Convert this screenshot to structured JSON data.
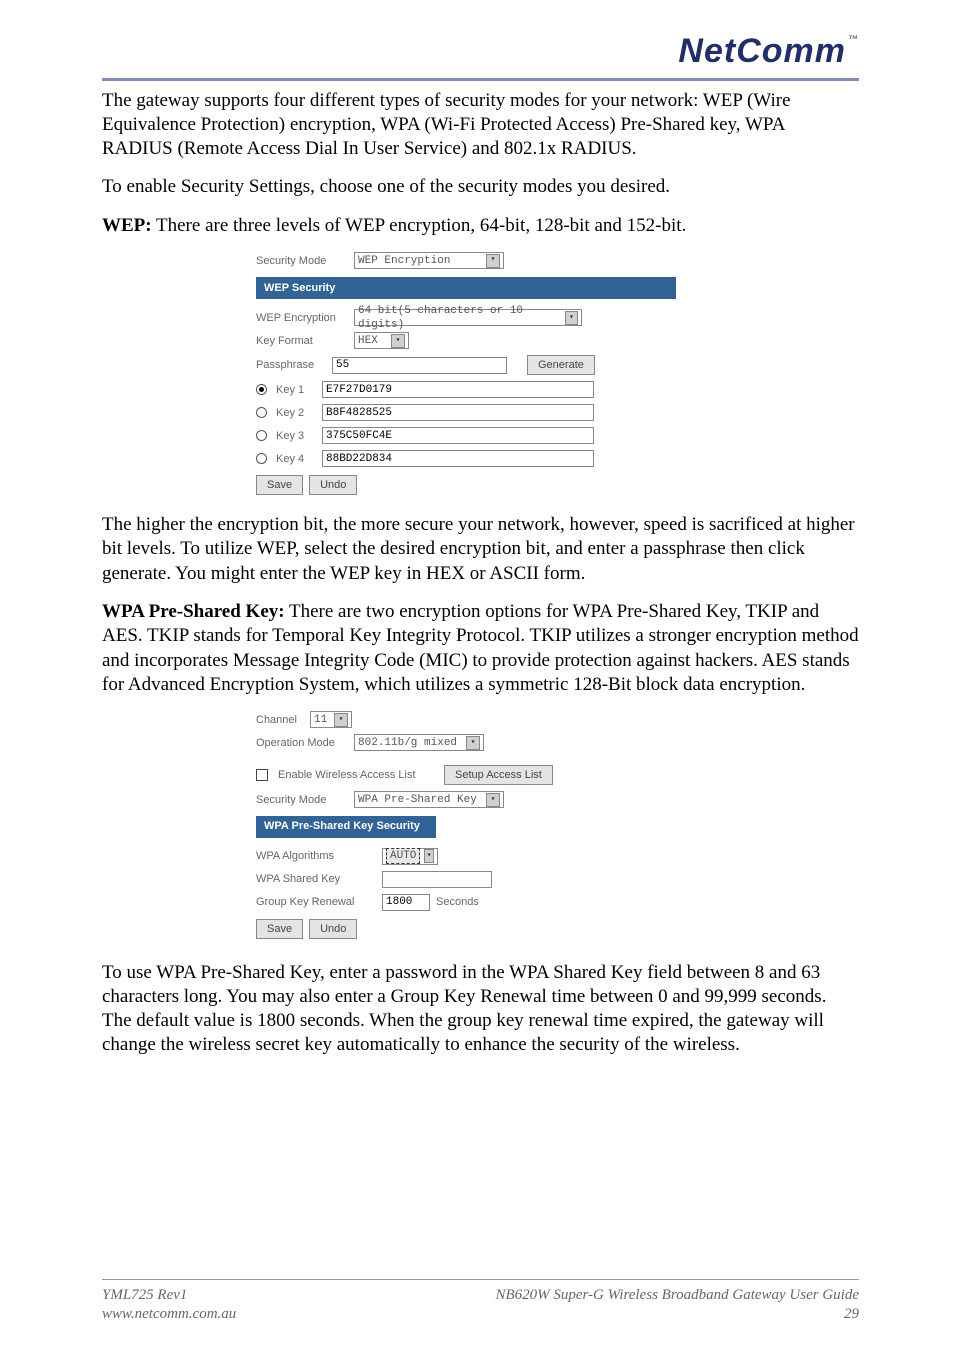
{
  "logo_text": "NetComm",
  "logo_tm": "™",
  "para1": "The gateway supports four different types of security modes for your network:  WEP (Wire Equivalence Protection) encryption, WPA (Wi-Fi Protected Access) Pre-Shared key, WPA RADIUS (Remote Access Dial In User Service) and 802.1x RADIUS.",
  "para2": "To enable Security Settings, choose one of the security modes you desired.",
  "wep_heading": "WEP:",
  "wep_heading_rest": " There are three levels of WEP encryption, 64-bit, 128-bit and 152-bit.",
  "wep_ui": {
    "security_mode_label": "Security Mode",
    "security_mode_value": "WEP Encryption",
    "section_title": "WEP Security",
    "wep_enc_label": "WEP Encryption",
    "wep_enc_value": "64 bit(5 characters or 10 digits)",
    "key_format_label": "Key Format",
    "key_format_value": "HEX",
    "passphrase_label": "Passphrase",
    "passphrase_value": "55",
    "generate_label": "Generate",
    "keys": [
      {
        "label": "Key 1",
        "value": "E7F27D0179",
        "selected": true
      },
      {
        "label": "Key 2",
        "value": "B8F4828525",
        "selected": false
      },
      {
        "label": "Key 3",
        "value": "375C50FC4E",
        "selected": false
      },
      {
        "label": "Key 4",
        "value": "88BD22D834",
        "selected": false
      }
    ],
    "save_label": "Save",
    "undo_label": "Undo"
  },
  "para3": "The higher the encryption bit, the more secure your network, however, speed is sacrificed at higher bit levels. To utilize WEP, select the desired encryption bit, and enter a passphrase then click generate. You might enter the WEP key in HEX or ASCII form.",
  "wpa_heading": "WPA Pre-Shared Key:",
  "wpa_heading_rest": " There are two encryption options for WPA Pre-Shared Key, TKIP and AES. TKIP stands for Temporal Key Integrity Protocol. TKIP utilizes a stronger encryption method and incorporates Message Integrity Code (MIC) to provide protection against hackers. AES stands for Advanced Encryption System, which utilizes a symmetric 128-Bit block data encryption.",
  "wpa_ui": {
    "channel_label": "Channel",
    "channel_value": "11",
    "op_mode_label": "Operation Mode",
    "op_mode_value": "802.11b/g mixed",
    "enable_access_label": "Enable Wireless Access List",
    "setup_access_label": "Setup Access List",
    "security_mode_label": "Security Mode",
    "security_mode_value": "WPA Pre-Shared Key",
    "section_title": "WPA Pre-Shared Key Security",
    "algo_label": "WPA Algorithms",
    "algo_value": "AUTO",
    "shared_key_label": "WPA Shared Key",
    "shared_key_value": "",
    "group_key_label": "Group Key Renewal",
    "group_key_value": "1800",
    "seconds_label": "Seconds",
    "save_label": "Save",
    "undo_label": "Undo"
  },
  "para4": "To use WPA Pre-Shared Key, enter a password in the WPA Shared Key field between 8 and 63 characters long. You may also enter a Group Key Renewal time between 0 and 99,999 seconds. The default value is 1800 seconds. When the group key renewal time expired, the gateway will change the wireless secret key automatically to enhance the security of the wireless.",
  "footer": {
    "left1": "YML725 Rev1",
    "left2": "www.netcomm.com.au",
    "right1": "NB620W Super-G Wireless Broadband  Gateway User Guide",
    "right2": "29"
  }
}
